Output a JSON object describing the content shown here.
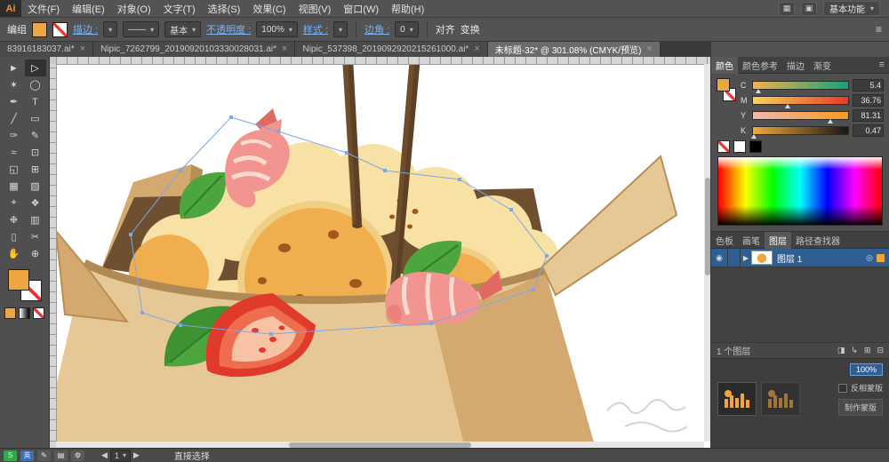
{
  "app": {
    "logo_text": "Ai",
    "workspace_label": "基本功能"
  },
  "menubar": {
    "items": [
      "文件(F)",
      "编辑(E)",
      "对象(O)",
      "文字(T)",
      "选择(S)",
      "效果(C)",
      "视图(V)",
      "窗口(W)",
      "帮助(H)"
    ],
    "right_icons": [
      {
        "name": "arrange-documents-icon",
        "glyph": "▦"
      },
      {
        "name": "screen-mode-icon",
        "glyph": "▣"
      }
    ]
  },
  "control_bar": {
    "selection_label": "编组",
    "stroke_label": "描边 :",
    "brush_value": "基本",
    "opacity_label": "不透明度 :",
    "opacity_value": "100%",
    "style_label": "样式 :",
    "corner_label": "边角 :",
    "corner_value": "0",
    "align_label": "对齐",
    "transform_label": "变换"
  },
  "document_tabs": [
    {
      "label": "83916183037.ai*",
      "active": false
    },
    {
      "label": "Nipic_7262799_20190920103330028031.ai*",
      "active": false
    },
    {
      "label": "Nipic_537398_2019092920215261000.ai*",
      "active": false
    },
    {
      "label": "未标题-32* @ 301.08% (CMYK/预览)",
      "active": true
    }
  ],
  "toolbar": {
    "tools": [
      {
        "name": "selection-tool",
        "glyph": "►"
      },
      {
        "name": "direct-selection-tool",
        "glyph": "▷",
        "active": true
      },
      {
        "name": "magic-wand-tool",
        "glyph": "✶"
      },
      {
        "name": "lasso-tool",
        "glyph": "◯"
      },
      {
        "name": "pen-tool",
        "glyph": "✒"
      },
      {
        "name": "type-tool",
        "glyph": "T"
      },
      {
        "name": "line-segment-tool",
        "glyph": "╱"
      },
      {
        "name": "rectangle-tool",
        "glyph": "▭"
      },
      {
        "name": "paintbrush-tool",
        "glyph": "✑"
      },
      {
        "name": "pencil-tool",
        "glyph": "✎"
      },
      {
        "name": "width-tool",
        "glyph": "≈"
      },
      {
        "name": "free-transform-tool",
        "glyph": "⊡"
      },
      {
        "name": "shape-builder-tool",
        "glyph": "◱"
      },
      {
        "name": "perspective-grid-tool",
        "glyph": "⊞"
      },
      {
        "name": "mesh-tool",
        "glyph": "▦"
      },
      {
        "name": "gradient-tool",
        "glyph": "▨"
      },
      {
        "name": "eyedropper-tool",
        "glyph": "⌖"
      },
      {
        "name": "blend-tool",
        "glyph": "❖"
      },
      {
        "name": "symbol-sprayer-tool",
        "glyph": "❉"
      },
      {
        "name": "column-graph-tool",
        "glyph": "▥"
      },
      {
        "name": "artboard-tool",
        "glyph": "▯"
      },
      {
        "name": "slice-tool",
        "glyph": "✂"
      },
      {
        "name": "hand-tool",
        "glyph": "✋"
      },
      {
        "name": "zoom-tool",
        "glyph": "⊕"
      }
    ],
    "mini_swatches": [
      {
        "name": "color-mode-button",
        "kind": "color"
      },
      {
        "name": "gradient-mode-button",
        "kind": "gradient"
      },
      {
        "name": "none-mode-button",
        "kind": "none"
      }
    ]
  },
  "color_panel": {
    "tabs": [
      "颜色",
      "颜色参考",
      "描边",
      "渐变"
    ],
    "active_index": 0,
    "sliders": [
      {
        "channel": "C",
        "value": "5.4",
        "gradient": [
          "#f2b14e",
          "#18a07c"
        ]
      },
      {
        "channel": "M",
        "value": "36.76",
        "gradient": [
          "#f5d35a",
          "#e93a27"
        ]
      },
      {
        "channel": "Y",
        "value": "81.31",
        "gradient": [
          "#f2b6ae",
          "#f59a1e"
        ]
      },
      {
        "channel": "K",
        "value": "0.47",
        "gradient": [
          "#f2a93c",
          "#161616"
        ]
      }
    ]
  },
  "panel_tabs": {
    "items": [
      "色板",
      "画笔",
      "图层",
      "路径查找器"
    ],
    "active_index": 2
  },
  "layers_panel": {
    "layer_name": "图层 1",
    "footer": "1 个图层",
    "footer_icons": [
      {
        "name": "clipping-mask-icon",
        "glyph": "◨"
      },
      {
        "name": "new-sublayer-icon",
        "glyph": "↳"
      },
      {
        "name": "new-layer-icon",
        "glyph": "⊞"
      },
      {
        "name": "delete-layer-icon",
        "glyph": "⊟"
      }
    ]
  },
  "transparency_panel": {
    "opacity": "100%",
    "invert_mask": "反相蒙版",
    "make_mask": "制作蒙版"
  },
  "status_bar": {
    "icons": [
      {
        "name": "sogou-icon",
        "glyph": "S",
        "bg": "#2faa4a"
      },
      {
        "name": "ime-language-badge",
        "glyph": "英",
        "bg": "#3d6fb4"
      },
      {
        "name": "pen-input-icon",
        "glyph": "✎"
      },
      {
        "name": "keyboard-icon",
        "glyph": "▤"
      },
      {
        "name": "settings-icon",
        "glyph": "⚙"
      }
    ],
    "artboard_value": "1",
    "tool_name": "直接选择"
  },
  "colors": {
    "accent_orange": "#eea63e",
    "selected_row": "#2f5e93",
    "box_light": "#e6c897",
    "box_mid": "#d4a96f",
    "box_dark": "#b98e55",
    "box_inner": "#6e4f30",
    "box_shadow": "#b08a55",
    "cream": "#f8e1a4",
    "cream_edge": "#f0cf84",
    "disc_orange": "#f1ae4e",
    "disc_dot": "#a2571a",
    "shrimp_pink": "#f29490",
    "shrimp_light": "#fbd9cf",
    "shrimp_dark": "#e06a62",
    "leaf_green": "#4ca53d",
    "leaf_dark": "#2f7d26",
    "tomato_red": "#e03a2c",
    "tomato_flesh": "#ef6d4f",
    "tomato_inner": "#f8c3a4",
    "chopstick": "#5e4024",
    "chopstick_light": "#7b5733",
    "selection_blue": "#7aa8e8"
  }
}
